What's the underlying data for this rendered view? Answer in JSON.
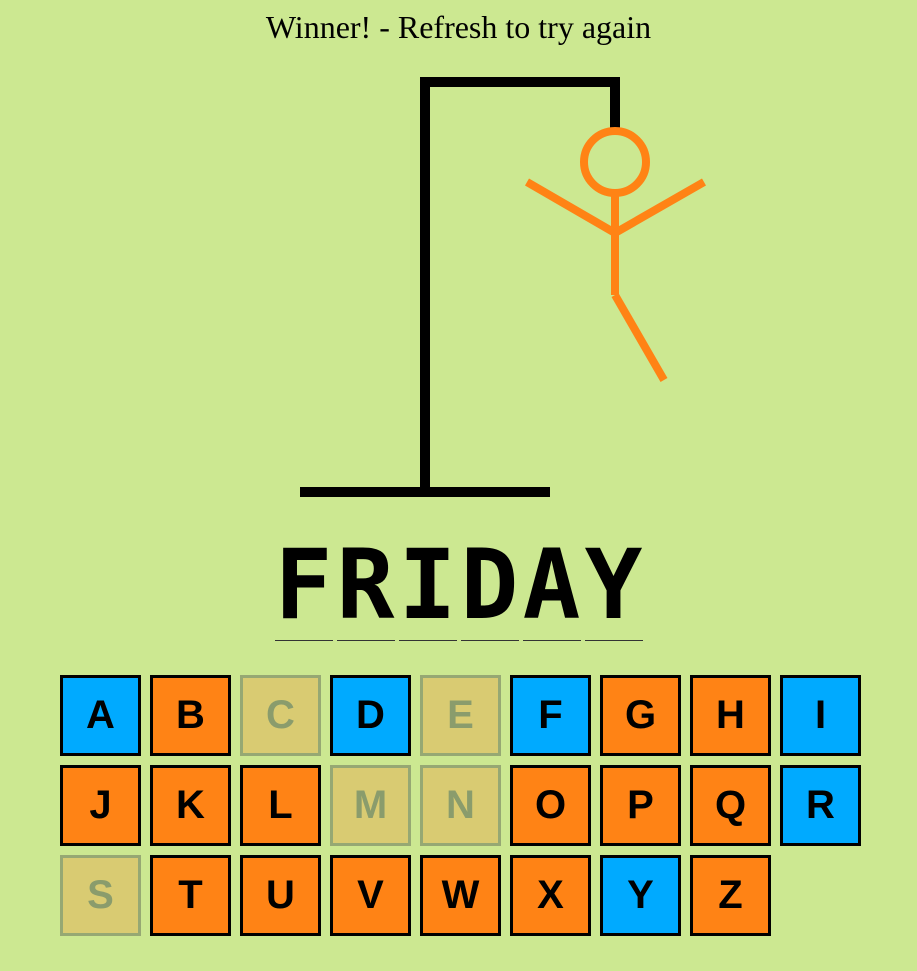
{
  "status_text": "Winner! - Refresh to try again",
  "colors": {
    "background": "#cce891",
    "gallows": "#000000",
    "figure": "#ff8315",
    "correct_guess": "#00aaff",
    "wrong_guess": "#ff8315",
    "unused_letter": "#d9cb72"
  },
  "word": [
    "F",
    "R",
    "I",
    "D",
    "A",
    "Y"
  ],
  "wrong_guess_count": 5,
  "keyboard": [
    {
      "letter": "A",
      "state": "hit"
    },
    {
      "letter": "B",
      "state": "miss"
    },
    {
      "letter": "C",
      "state": "unused"
    },
    {
      "letter": "D",
      "state": "hit"
    },
    {
      "letter": "E",
      "state": "unused"
    },
    {
      "letter": "F",
      "state": "hit"
    },
    {
      "letter": "G",
      "state": "miss"
    },
    {
      "letter": "H",
      "state": "miss"
    },
    {
      "letter": "I",
      "state": "hit"
    },
    {
      "letter": "J",
      "state": "miss"
    },
    {
      "letter": "K",
      "state": "miss"
    },
    {
      "letter": "L",
      "state": "miss"
    },
    {
      "letter": "M",
      "state": "unused"
    },
    {
      "letter": "N",
      "state": "unused"
    },
    {
      "letter": "O",
      "state": "miss"
    },
    {
      "letter": "P",
      "state": "miss"
    },
    {
      "letter": "Q",
      "state": "miss"
    },
    {
      "letter": "R",
      "state": "hit"
    },
    {
      "letter": "S",
      "state": "unused"
    },
    {
      "letter": "T",
      "state": "miss"
    },
    {
      "letter": "U",
      "state": "miss"
    },
    {
      "letter": "V",
      "state": "miss"
    },
    {
      "letter": "W",
      "state": "miss"
    },
    {
      "letter": "X",
      "state": "miss"
    },
    {
      "letter": "Y",
      "state": "hit"
    },
    {
      "letter": "Z",
      "state": "miss"
    }
  ]
}
